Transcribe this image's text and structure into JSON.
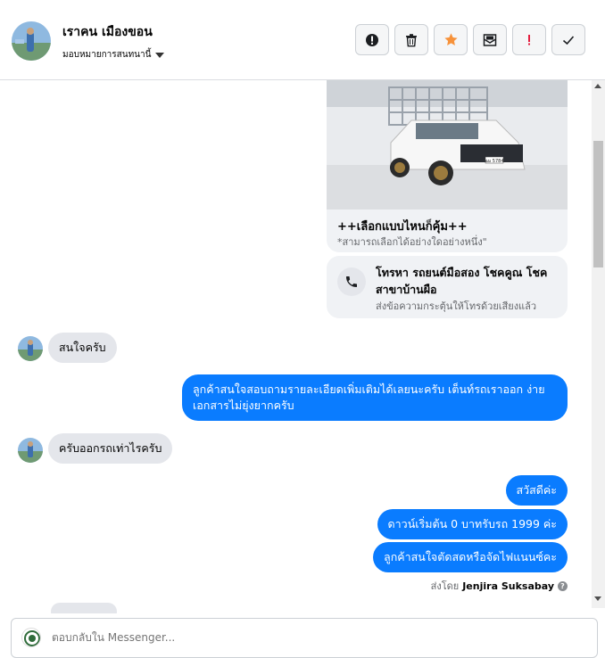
{
  "header": {
    "contact_name": "เราคน เมืองขอน",
    "assign_label": "มอบหมายการสนทนานี้",
    "actions": [
      {
        "name": "report-button",
        "icon": "exclamation-circle-icon"
      },
      {
        "name": "delete-button",
        "icon": "trash-icon"
      },
      {
        "name": "star-button",
        "icon": "star-icon",
        "color": "#f7923a"
      },
      {
        "name": "mark-unread-button",
        "icon": "envelope-icon"
      },
      {
        "name": "spam-button",
        "icon": "exclamation-icon",
        "color": "#e41e3f"
      },
      {
        "name": "done-button",
        "icon": "check-icon"
      }
    ]
  },
  "messages": {
    "card": {
      "title": "++เลือกแบบไหนก็คุ้ม++",
      "subtitle": "*สามารถเลือกได้อย่างใดอย่างหนึ่ง\"",
      "plate": "ฉม 5784"
    },
    "call_card": {
      "title": "โทรหา รถยนต์มือสอง โชคคูณ โชค สาขาบ้านผือ",
      "subtitle": "ส่งข้อความกระตุ้นให้โทรด้วยเสียงแล้ว"
    },
    "in_1": "สนใจครับ",
    "out_1": "ลูกค้าสนใจสอบถามรายละเอียดเพิ่มเติมได้เลยนะครับ เต็นท์รถเราออก ง่ายเอกสารไม่ยุ่งยากครับ",
    "in_2": "ครับออกรถเท่าไรครับ",
    "out_2": "สวัสดีค่ะ",
    "out_3": "ดาวน์เริ่มต้น 0 บาทรับรถ 1999 ค่ะ",
    "out_4": "ลูกค้าสนใจตัดสดหรือจัดไฟแนนซ์คะ",
    "sent_by_prefix": "ส่งโดย",
    "sent_by_name": "Jenjira Suksabay",
    "help_mark": "?"
  },
  "composer": {
    "placeholder": "ตอบกลับใน Messenger..."
  },
  "colors": {
    "outgoing_bubble": "#0a7cff",
    "incoming_bubble": "#e4e6eb"
  }
}
